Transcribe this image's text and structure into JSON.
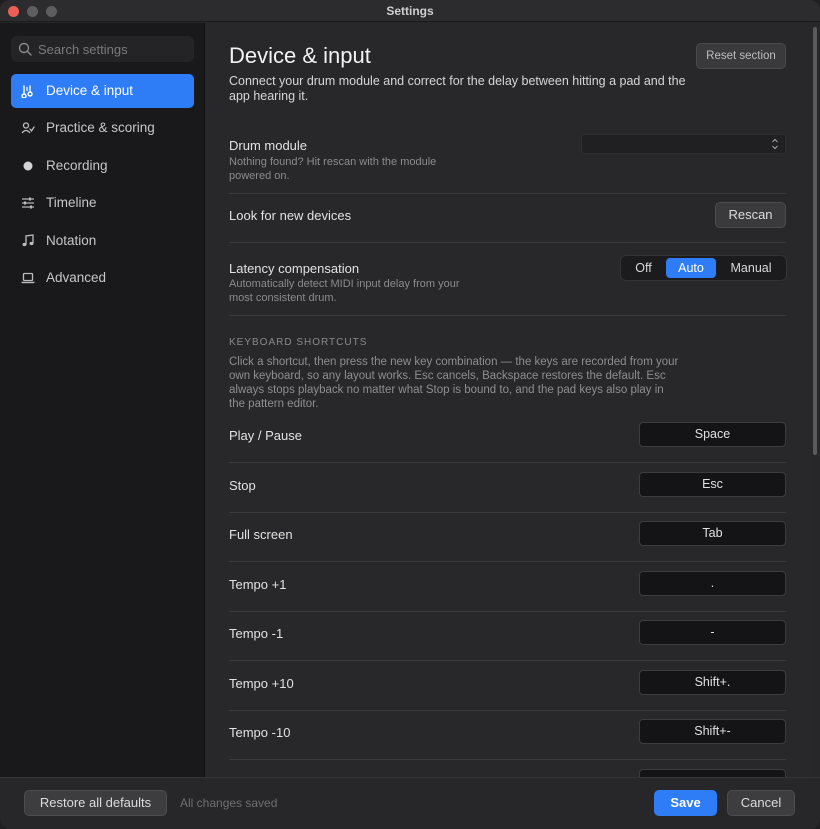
{
  "window": {
    "title": "Settings"
  },
  "sidebar": {
    "search_placeholder": "Search settings",
    "items": [
      {
        "label": "Device & input",
        "icon": "device-input-icon",
        "active": true
      },
      {
        "label": "Practice & scoring",
        "icon": "practice-scoring-icon",
        "active": false
      },
      {
        "label": "Recording",
        "icon": "record-dot-icon",
        "active": false
      },
      {
        "label": "Timeline",
        "icon": "sliders-icon",
        "active": false
      },
      {
        "label": "Notation",
        "icon": "music-note-icon",
        "active": false
      },
      {
        "label": "Advanced",
        "icon": "laptop-icon",
        "active": false
      }
    ]
  },
  "main": {
    "title": "Device & input",
    "description": "Connect your drum module and correct for the delay between hitting a pad and the app hearing it.",
    "reset_label": "Reset section",
    "drum_module": {
      "label": "Drum module",
      "help": "Nothing found? Hit rescan with the module powered on.",
      "value": ""
    },
    "look_for_devices": {
      "label": "Look for new devices",
      "button": "Rescan"
    },
    "latency": {
      "label": "Latency compensation",
      "help": "Automatically detect MIDI input delay from your most consistent drum.",
      "options": [
        "Off",
        "Auto",
        "Manual"
      ],
      "selected": "Auto"
    },
    "shortcuts": {
      "heading": "KEYBOARD SHORTCUTS",
      "description": "Click a shortcut, then press the new key combination — the keys are recorded from your own keyboard, so any layout works. Esc cancels, Backspace restores the default. Esc always stops playback no matter what Stop is bound to, and the pad keys also play in the pattern editor.",
      "rows": [
        {
          "label": "Play / Pause",
          "key": "Space"
        },
        {
          "label": "Stop",
          "key": "Esc"
        },
        {
          "label": "Full screen",
          "key": "Tab"
        },
        {
          "label": "Tempo +1",
          "key": "."
        },
        {
          "label": "Tempo -1",
          "key": "-"
        },
        {
          "label": "Tempo +10",
          "key": "Shift+."
        },
        {
          "label": "Tempo -10",
          "key": "Shift+-"
        }
      ]
    }
  },
  "footer": {
    "restore_label": "Restore all defaults",
    "status": "All changes saved",
    "save_label": "Save",
    "cancel_label": "Cancel"
  },
  "colors": {
    "accent": "#2f7df6",
    "close": "#ec5f57",
    "background": "#28282a",
    "sidebar": "#19191b"
  }
}
